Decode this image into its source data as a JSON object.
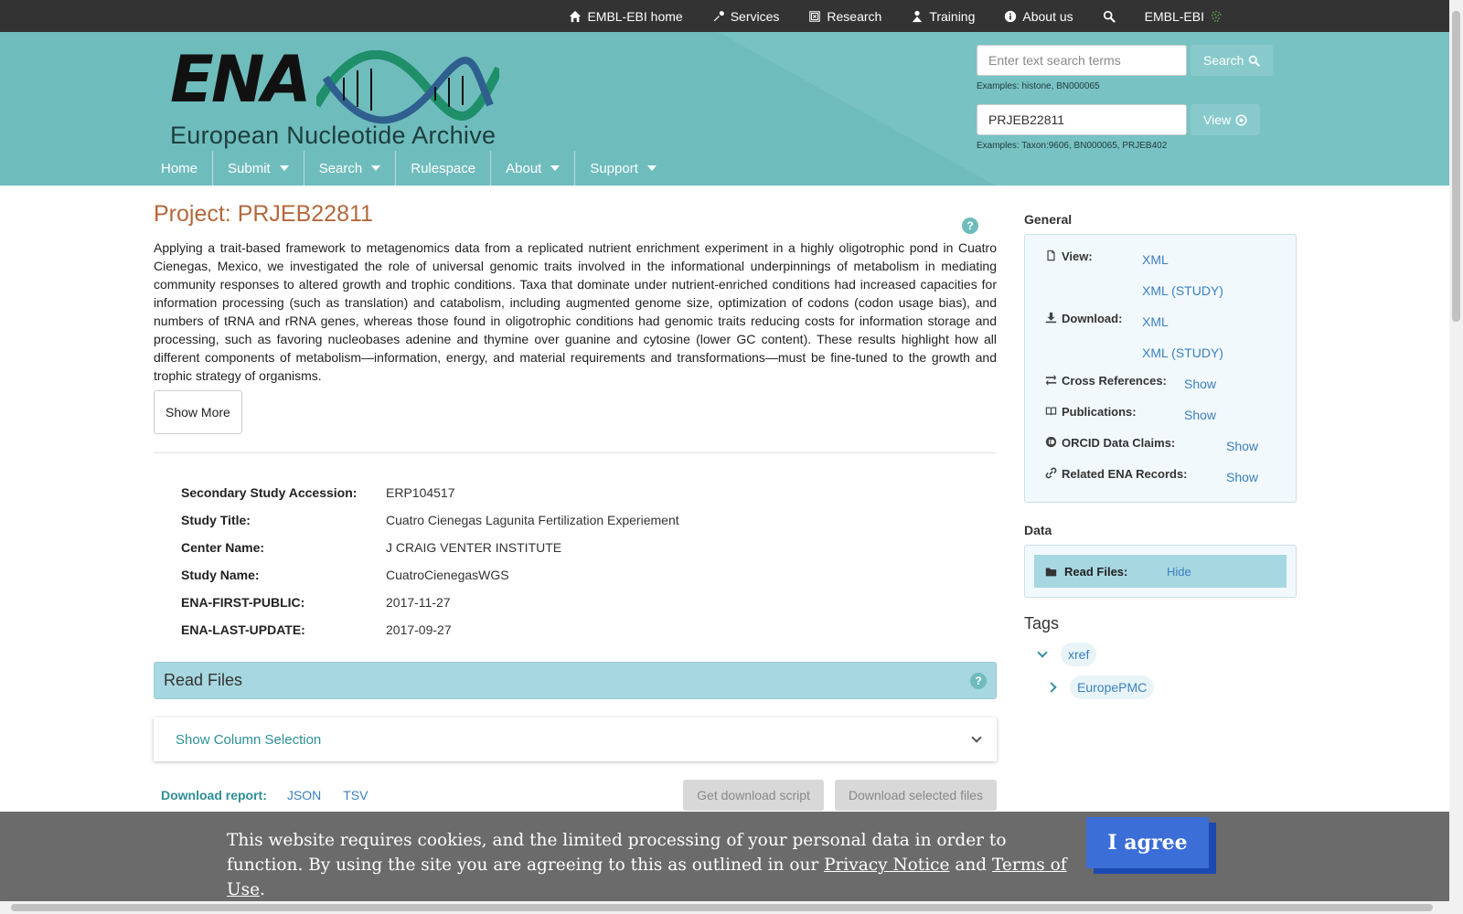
{
  "topbar": {
    "items": [
      {
        "label": "EMBL-EBI home",
        "icon": "home-icon"
      },
      {
        "label": "Services",
        "icon": "wrench-icon"
      },
      {
        "label": "Research",
        "icon": "research-icon"
      },
      {
        "label": "Training",
        "icon": "training-icon"
      },
      {
        "label": "About us",
        "icon": "info-icon"
      }
    ],
    "brand": "EMBL-EBI"
  },
  "header": {
    "logo_text": "ENA",
    "logo_subtitle": "European Nucleotide Archive",
    "search": {
      "placeholder": "Enter text search terms",
      "button": "Search",
      "example": "Examples: histone, BN000065"
    },
    "view": {
      "value": "PRJEB22811",
      "button": "View",
      "example": "Examples: Taxon:9606, BN000065, PRJEB402"
    },
    "nav": [
      {
        "label": "Home",
        "dropdown": false
      },
      {
        "label": "Submit",
        "dropdown": true
      },
      {
        "label": "Search",
        "dropdown": true
      },
      {
        "label": "Rulespace",
        "dropdown": false
      },
      {
        "label": "About",
        "dropdown": true
      },
      {
        "label": "Support",
        "dropdown": true
      }
    ]
  },
  "main": {
    "title": "Project: PRJEB22811",
    "description": "Applying a trait-based framework to metagenomics data from a replicated nutrient enrichment experiment in a highly oligotrophic pond in Cuatro Cienegas, Mexico, we investigated the role of universal genomic traits involved in the informational underpinnings of metabolism in mediating community responses to altered growth and trophic conditions. Taxa that dominate under nutrient-enriched conditions had increased capacities for information processing (such as translation) and catabolism, including augmented genome size, optimization of codons (codon usage bias), and numbers of tRNA and rRNA genes, whereas those found in oligotrophic conditions had genomic traits reducing costs for information storage and processing, such as favoring nucleobases adenine and thymine over guanine and cytosine (lower GC content). These results highlight how all different components of metabolism—information, energy, and material requirements and transformations—must be fine-tuned to the growth and trophic strategy of organisms.",
    "show_more": "Show More",
    "details": [
      {
        "label": "Secondary Study Accession:",
        "value": "ERP104517"
      },
      {
        "label": "Study Title:",
        "value": "Cuatro Cienegas Lagunita Fertilization Experiement"
      },
      {
        "label": "Center Name:",
        "value": "J CRAIG VENTER INSTITUTE"
      },
      {
        "label": "Study Name:",
        "value": "CuatroCienegasWGS"
      },
      {
        "label": "ENA-FIRST-PUBLIC:",
        "value": "2017-11-27"
      },
      {
        "label": "ENA-LAST-UPDATE:",
        "value": "2017-09-27"
      }
    ],
    "read_files_title": "Read Files",
    "column_selection": "Show Column Selection",
    "download_report_label": "Download report:",
    "download_links": [
      "JSON",
      "TSV"
    ],
    "get_script_button": "Get download script",
    "download_selected_button": "Download selected files",
    "help": "?"
  },
  "sidebar": {
    "general_title": "General",
    "view_label": "View:",
    "view_links": [
      "XML",
      "XML (STUDY)"
    ],
    "download_label": "Download:",
    "download_links": [
      "XML",
      "XML (STUDY)"
    ],
    "xrefs_label": "Cross References:",
    "publications_label": "Publications:",
    "orcid_label": "ORCID Data Claims:",
    "related_label": "Related ENA Records:",
    "show": "Show",
    "data_title": "Data",
    "read_files_label": "Read Files:",
    "hide": "Hide",
    "tags_title": "Tags",
    "tags": [
      "xref",
      "EuropePMC"
    ]
  },
  "cookie": {
    "text_before": "This website requires cookies, and the limited processing of your personal data in order to function. By using the site you are agreeing to this as outlined in our ",
    "privacy": "Privacy Notice",
    "and": " and ",
    "terms": "Terms of Use",
    "end": ".",
    "agree": "I agree"
  },
  "colors": {
    "topbar": "#333333",
    "header": "#6fbcbd",
    "title": "#b3683b",
    "link": "#3a7fbf",
    "read_files_bar": "#a7d7e0",
    "cookie_bg": "#6b6b6b",
    "agree_button": "#3b6ed6"
  }
}
